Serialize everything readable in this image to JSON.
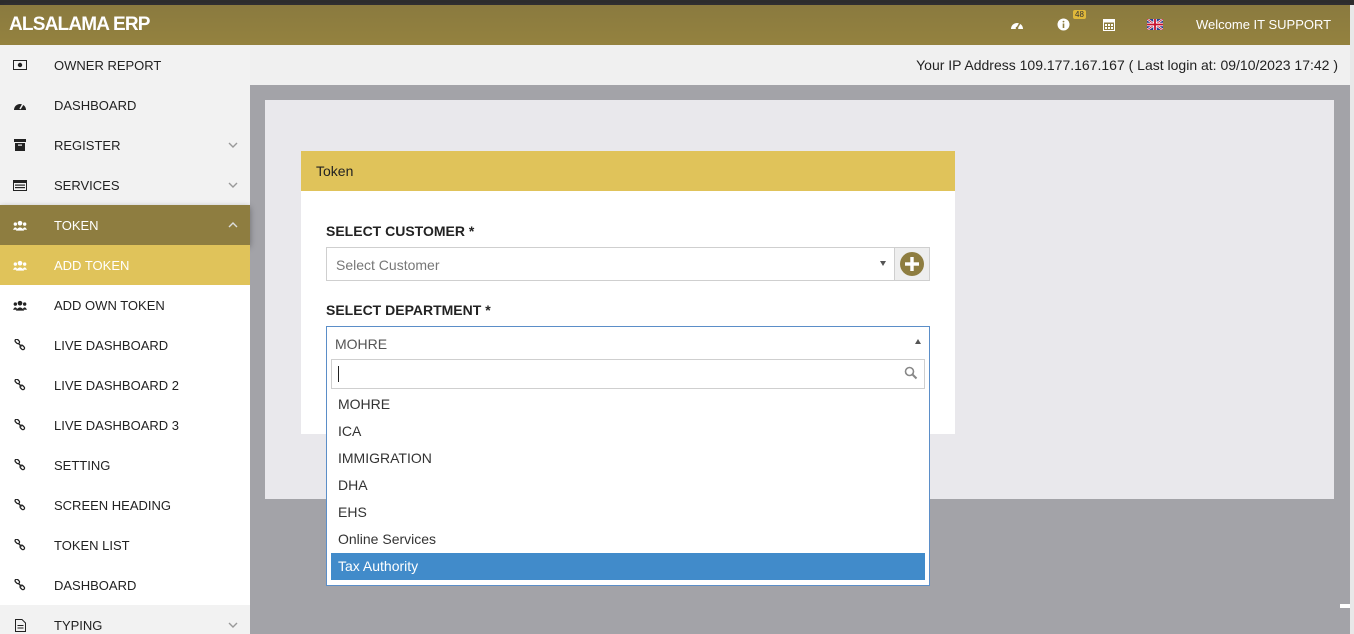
{
  "app": {
    "title": "ALSALAMA ERP",
    "badge_count": "48",
    "welcome": "Welcome IT SUPPORT"
  },
  "topbar_icons": [
    "dashboard-icon",
    "info-icon",
    "calendar-icon",
    "uk-flag-icon"
  ],
  "sidebar": {
    "items": [
      {
        "label": "OWNER REPORT",
        "icon": "money-icon"
      },
      {
        "label": "DASHBOARD",
        "icon": "dashboard-icon"
      },
      {
        "label": "REGISTER",
        "icon": "archive-icon",
        "chevron": "down"
      },
      {
        "label": "SERVICES",
        "icon": "list-icon",
        "chevron": "down"
      },
      {
        "label": "TOKEN",
        "icon": "users-icon",
        "chevron": "up",
        "state": "open"
      },
      {
        "label": "ADD TOKEN",
        "icon": "users-icon",
        "state": "active"
      },
      {
        "label": "ADD OWN TOKEN",
        "icon": "users-icon"
      },
      {
        "label": "LIVE DASHBOARD",
        "icon": "link-icon"
      },
      {
        "label": "LIVE DASHBOARD 2",
        "icon": "link-icon"
      },
      {
        "label": "LIVE DASHBOARD 3",
        "icon": "link-icon"
      },
      {
        "label": "SETTING",
        "icon": "link-icon"
      },
      {
        "label": "SCREEN HEADING",
        "icon": "link-icon"
      },
      {
        "label": "TOKEN LIST",
        "icon": "link-icon"
      },
      {
        "label": "DASHBOARD",
        "icon": "link-icon"
      },
      {
        "label": "TYPING",
        "icon": "file-icon",
        "chevron": "down"
      }
    ]
  },
  "ip_info": "Your IP Address 109.177.167.167 ( Last login at: 09/10/2023 17:42 )",
  "card": {
    "title": "Token",
    "customer_label": "SELECT CUSTOMER *",
    "customer_placeholder": "Select Customer",
    "department_label": "SELECT DEPARTMENT *",
    "department_value": "MOHRE",
    "search_value": "",
    "department_options": [
      "MOHRE",
      "ICA",
      "IMMIGRATION",
      "DHA",
      "EHS",
      "Online Services",
      "Tax Authority"
    ],
    "highlighted_option": "Tax Authority"
  },
  "colors": {
    "topbar": "#8e7d40",
    "accent": "#e0c35a",
    "highlight": "#418bca"
  }
}
